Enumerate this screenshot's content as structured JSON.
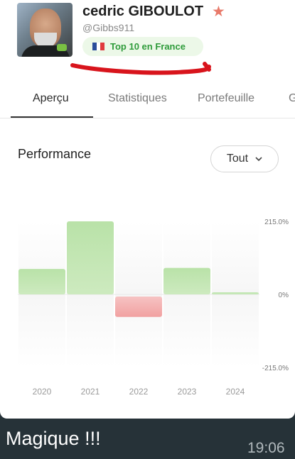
{
  "profile": {
    "name": "cedric GIBOULOT",
    "handle": "@Gibbs911",
    "badge": "Top 10 en France",
    "star_icon": "star-icon",
    "flag_colors": [
      "#2a4d9b",
      "#ffffff",
      "#e03a3e"
    ]
  },
  "tabs": [
    {
      "label": "Aperçu",
      "active": true
    },
    {
      "label": "Statistiques",
      "active": false
    },
    {
      "label": "Portefeuille",
      "active": false
    },
    {
      "label": "G",
      "active": false
    }
  ],
  "performance": {
    "title": "Performance",
    "range_label": "Tout"
  },
  "chart_data": {
    "type": "bar",
    "categories": [
      "2020",
      "2021",
      "2022",
      "2023",
      "2024"
    ],
    "values": [
      75,
      215,
      -60,
      78,
      6
    ],
    "ylim": [
      -215,
      215
    ],
    "yticks": [
      "215.0%",
      "0%",
      "-215.0%"
    ],
    "positive_color": "#b9e2a8",
    "negative_color": "#f1a1a1"
  },
  "message": {
    "text": "Magique !!!",
    "time": "19:06"
  }
}
